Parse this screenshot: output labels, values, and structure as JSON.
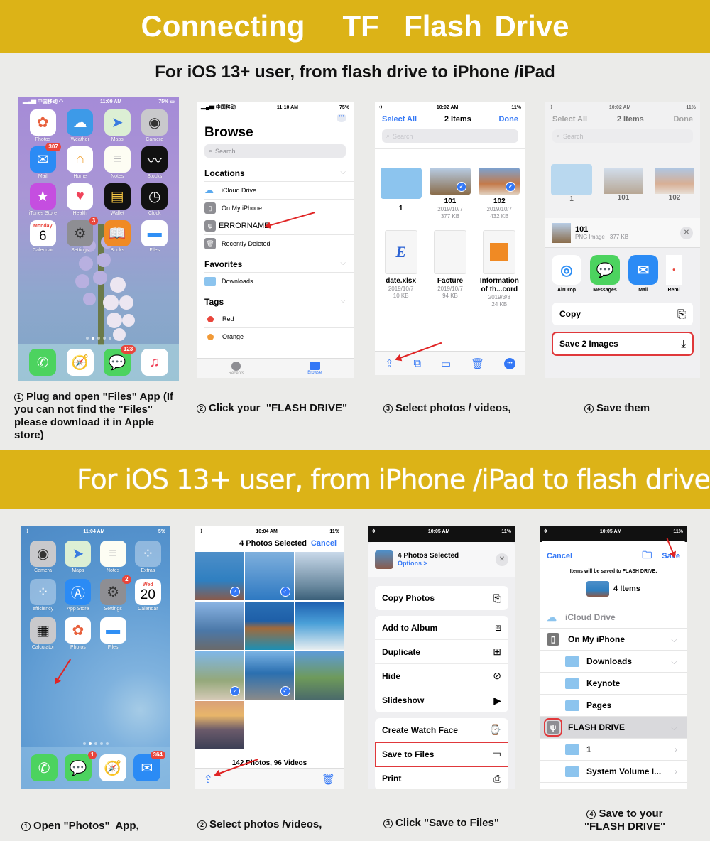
{
  "banner_top": "Connecting   TF  Flash Drive",
  "section1": {
    "heading": "For iOS 13+ user, from flash drive to iPhone /iPad",
    "phone1": {
      "status": {
        "carrier": "中国移动",
        "time": "11:09 AM",
        "battery": "75%"
      },
      "apps": [
        {
          "label": "Photos",
          "icon": "photos-icon",
          "badge": ""
        },
        {
          "label": "Weather",
          "icon": "weather-icon",
          "badge": ""
        },
        {
          "label": "Maps",
          "icon": "maps-icon",
          "badge": ""
        },
        {
          "label": "Camera",
          "icon": "camera-icon",
          "badge": ""
        },
        {
          "label": "Mail",
          "icon": "mail-icon",
          "badge": "307"
        },
        {
          "label": "Home",
          "icon": "home-icon",
          "badge": ""
        },
        {
          "label": "Notes",
          "icon": "notes-icon",
          "badge": ""
        },
        {
          "label": "Stocks",
          "icon": "stocks-icon",
          "badge": ""
        },
        {
          "label": "iTunes Store",
          "icon": "star-icon",
          "badge": ""
        },
        {
          "label": "Health",
          "icon": "heart-icon",
          "badge": ""
        },
        {
          "label": "Wallet",
          "icon": "wallet-icon",
          "badge": ""
        },
        {
          "label": "Clock",
          "icon": "clock-icon",
          "badge": ""
        },
        {
          "label": "Calendar",
          "icon": "calendar-icon",
          "badge": "",
          "day": "Monday",
          "date": "6"
        },
        {
          "label": "Settings",
          "icon": "gear-icon",
          "badge": "3"
        },
        {
          "label": "Books",
          "icon": "book-icon",
          "badge": ""
        },
        {
          "label": "Files",
          "icon": "folder-icon",
          "badge": ""
        }
      ],
      "dock": [
        {
          "icon": "phone-icon",
          "badge": ""
        },
        {
          "icon": "safari-icon",
          "badge": ""
        },
        {
          "icon": "messages-icon",
          "badge": "123"
        },
        {
          "icon": "music-icon",
          "badge": ""
        }
      ]
    },
    "phone2": {
      "status": {
        "carrier": "中国移动",
        "time": "11:10 AM",
        "battery": "75%"
      },
      "title": "Browse",
      "search_placeholder": "Search",
      "locations_header": "Locations",
      "locations": [
        "iCloud Drive",
        "On My iPhone",
        "ERRORNAME",
        "Recently Deleted"
      ],
      "favorites_header": "Favorites",
      "favorites": [
        "Downloads"
      ],
      "tags_header": "Tags",
      "tags": [
        {
          "label": "Red",
          "color": "#e9453b"
        },
        {
          "label": "Orange",
          "color": "#f19a37"
        }
      ],
      "tabs": [
        "Recents",
        "Browse"
      ]
    },
    "phone3": {
      "status": {
        "time": "10:02 AM",
        "battery": "11%"
      },
      "select_all": "Select All",
      "title": "2 Items",
      "done": "Done",
      "search_placeholder": "Search",
      "files": [
        {
          "name": "1",
          "date": "",
          "size": "",
          "kind": "folder"
        },
        {
          "name": "101",
          "date": "2019/10/7",
          "size": "377 KB",
          "kind": "image",
          "selected": true
        },
        {
          "name": "102",
          "date": "2019/10/7",
          "size": "432 KB",
          "kind": "image",
          "selected": true
        },
        {
          "name": "date.xlsx",
          "date": "2019/10/7",
          "size": "10 KB",
          "kind": "doc"
        },
        {
          "name": "Facture",
          "date": "2019/10/7",
          "size": "94 KB",
          "kind": "doc"
        },
        {
          "name": "Information of th...cord",
          "date": "2019/3/8",
          "size": "24 KB",
          "kind": "doc"
        }
      ]
    },
    "phone4": {
      "status": {
        "time": "10:02 AM",
        "battery": "11%"
      },
      "select_all": "Select All",
      "title": "2 Items",
      "done": "Done",
      "search_placeholder": "Search",
      "files": [
        "1",
        "101",
        "102"
      ],
      "sheet_title": "101",
      "sheet_subtitle": "PNG Image · 377 KB",
      "share_apps": [
        "AirDrop",
        "Messages",
        "Mail",
        "Remi"
      ],
      "actions": [
        "Copy",
        "Save 2 Images"
      ]
    },
    "captions": [
      "Plug and  open \"Files\" App (If you can not find the  \"Files\"  please download it in Apple store)",
      "Click your  \"FLASH DRIVE\"",
      "Select photos / videos,",
      "Save them"
    ]
  },
  "section2": {
    "heading": "For iOS 13+ user, from iPhone /iPad to flash drive",
    "phone1": {
      "status": {
        "time": "11:04 AM",
        "battery": "5%"
      },
      "apps": [
        {
          "label": "Camera",
          "icon": "camera-icon",
          "badge": ""
        },
        {
          "label": "Maps",
          "icon": "maps-icon",
          "badge": ""
        },
        {
          "label": "Notes",
          "icon": "notes-icon",
          "badge": ""
        },
        {
          "label": "Extras",
          "icon": "app-folder-icon",
          "badge": ""
        },
        {
          "label": "efficiency",
          "icon": "app-folder-icon",
          "badge": ""
        },
        {
          "label": "App Store",
          "icon": "app-store-icon",
          "badge": ""
        },
        {
          "label": "Settings",
          "icon": "gear-icon",
          "badge": "2"
        },
        {
          "label": "Calendar",
          "icon": "calendar-icon",
          "badge": "",
          "day": "Wed",
          "date": "20"
        },
        {
          "label": "Calculator",
          "icon": "calculator-icon",
          "badge": ""
        },
        {
          "label": "Photos",
          "icon": "photos-icon",
          "badge": ""
        },
        {
          "label": "Files",
          "icon": "folder-icon",
          "badge": ""
        }
      ],
      "dock": [
        {
          "icon": "phone-icon",
          "badge": ""
        },
        {
          "icon": "messages-icon",
          "badge": "1"
        },
        {
          "icon": "safari-icon",
          "badge": ""
        },
        {
          "icon": "mail-icon",
          "badge": "364"
        }
      ]
    },
    "phone2": {
      "status": {
        "time": "10:04 AM",
        "battery": "11%"
      },
      "title": "4 Photos Selected",
      "cancel": "Cancel",
      "selected_count": 4,
      "footer": "142 Photos, 96 Videos"
    },
    "phone3": {
      "status": {
        "time": "10:05 AM",
        "battery": "11%"
      },
      "title": "4 Photos Selected",
      "options": "Options >",
      "groups": [
        [
          {
            "label": "Copy Photos",
            "icon": "copy-icon"
          }
        ],
        [
          {
            "label": "Add to Album",
            "icon": "album-icon"
          },
          {
            "label": "Duplicate",
            "icon": "duplicate-icon"
          },
          {
            "label": "Hide",
            "icon": "eye-slash-icon"
          },
          {
            "label": "Slideshow",
            "icon": "play-icon"
          }
        ],
        [
          {
            "label": "Create Watch Face",
            "icon": "watch-icon"
          },
          {
            "label": "Save to Files",
            "icon": "folder-icon",
            "highlight": true
          },
          {
            "label": "Print",
            "icon": "printer-icon"
          }
        ]
      ]
    },
    "phone4": {
      "status": {
        "time": "10:05 AM",
        "battery": "11%"
      },
      "cancel": "Cancel",
      "save": "Save",
      "note": "Items will be saved to FLASH DRIVE.",
      "items": "4 Items",
      "rows": [
        {
          "label": "iCloud Drive",
          "level": 0,
          "chev": ""
        },
        {
          "label": "On My iPhone",
          "level": 0,
          "chev": "down"
        },
        {
          "label": "Downloads",
          "level": 1,
          "chev": "down"
        },
        {
          "label": "Keynote",
          "level": 1,
          "chev": ""
        },
        {
          "label": "Pages",
          "level": 1,
          "chev": ""
        },
        {
          "label": "FLASH DRIVE",
          "level": 0,
          "chev": "down",
          "selected": true
        },
        {
          "label": "1",
          "level": 1,
          "chev": "right"
        },
        {
          "label": "System Volume I...",
          "level": 1,
          "chev": "right"
        }
      ]
    },
    "captions": [
      "Open \"Photos\"  App,",
      "Select photos /videos,",
      "Click \"Save to Files\"",
      "Save to your \"FLASH DRIVE\""
    ]
  },
  "colors": {
    "banner": "#dcb317",
    "ios_blue": "#3478f6",
    "highlight_red": "#e0383b",
    "background": "#ebebe9"
  }
}
